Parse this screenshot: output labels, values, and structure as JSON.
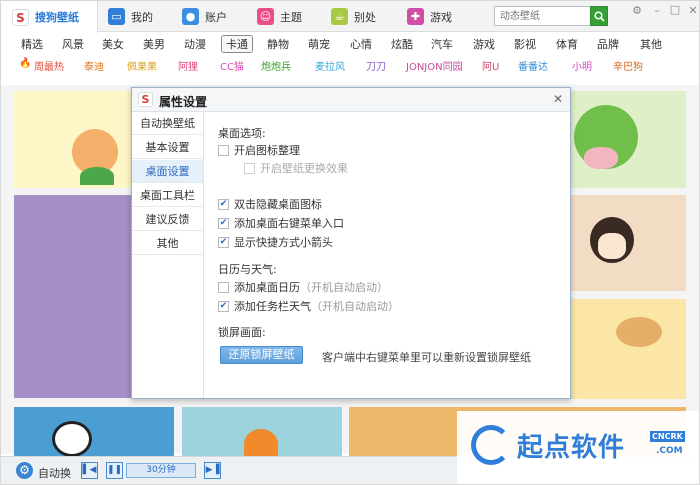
{
  "tabs": [
    {
      "label": "搜狗壁纸",
      "icon": "sogou-logo-icon",
      "color": "#e13a3a"
    },
    {
      "label": "我的",
      "icon": "monitor-icon",
      "color": "#2f7fd9"
    },
    {
      "label": "账户",
      "icon": "user-icon",
      "color": "#3c8ee0"
    },
    {
      "label": "主题",
      "icon": "theme-icon",
      "color": "#e84e8a"
    },
    {
      "label": "别处",
      "icon": "coffee-icon",
      "color": "#a9c940"
    },
    {
      "label": "游戏",
      "icon": "gamepad-icon",
      "color": "#d04ea8"
    }
  ],
  "search": {
    "placeholder": "动态壁纸"
  },
  "categories": [
    "精选",
    "风景",
    "美女",
    "美男",
    "动漫",
    "卡通",
    "静物",
    "萌宠",
    "心情",
    "炫酷",
    "汽车",
    "游戏",
    "影视",
    "体育",
    "品牌",
    "其他"
  ],
  "selected_category": "卡通",
  "stars": [
    "周最热",
    "泰迪",
    "佩果果",
    "阿狸",
    "CC猫",
    "炮炮兵",
    "麦拉风",
    "刀刀",
    "JONJON同园",
    "阿U",
    "番番达",
    "小明",
    "辛巴狗"
  ],
  "bottom": {
    "auto_label": "自动换",
    "interval": "30分钟"
  },
  "dialog": {
    "title": "属性设置",
    "sidebar": [
      "自动换壁纸",
      "基本设置",
      "桌面设置",
      "桌面工具栏",
      "建议反馈",
      "其他"
    ],
    "active_index": 2,
    "desktop_options_title": "桌面选项:",
    "opt_icon_arrange": "开启图标整理",
    "opt_icon_effect": "开启壁纸更换效果",
    "opt_dblclick_hide": "双击隐藏桌面图标",
    "opt_context_menu": "添加桌面右键菜单入口",
    "opt_shortcut_arrow": "显示快捷方式小箭头",
    "calendar_title": "日历与天气:",
    "opt_calendar": "添加桌面日历",
    "opt_calendar_hint": "（开机自动启动）",
    "opt_weather": "添加任务栏天气",
    "opt_weather_hint": "（开机自动启动）",
    "lock_title": "锁屏画面:",
    "reset_button": "还原锁屏壁纸",
    "reset_hint": "客户端中右键菜单里可以重新设置锁屏壁纸"
  },
  "watermark": {
    "text": "起点软件",
    "badge": "CNCRK",
    "domain": ".COM"
  }
}
